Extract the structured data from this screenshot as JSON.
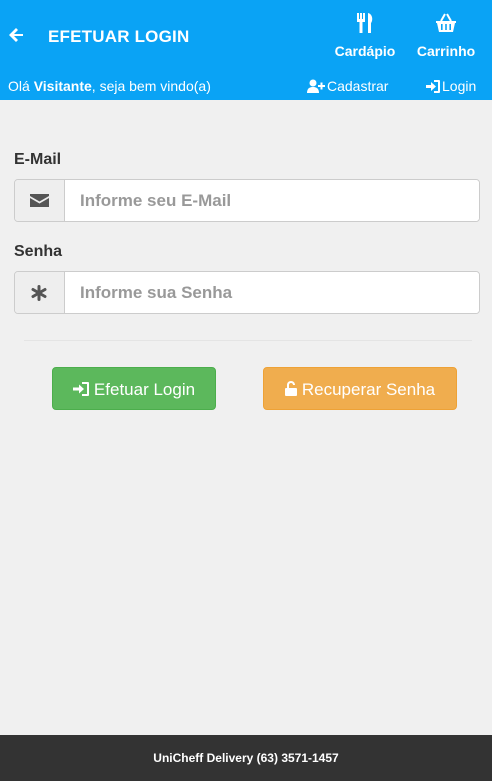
{
  "colors": {
    "header_bg": "#0aa3f5",
    "success": "#5cb85c",
    "warning": "#f0ad4e",
    "footer_bg": "#333333",
    "page_bg": "#f0f0f0"
  },
  "header": {
    "back_icon": "arrow-left-icon",
    "title": "EFETUAR LOGIN",
    "nav": [
      {
        "label": "Cardápio",
        "icon": "cutlery-icon"
      },
      {
        "label": "Carrinho",
        "icon": "basket-icon"
      }
    ]
  },
  "subbar": {
    "greeting_prefix": "Olá ",
    "user": "Visitante",
    "greeting_suffix": ", seja bem vindo(a)",
    "register_label": "Cadastrar",
    "register_icon": "user-plus-icon",
    "login_label": "Login",
    "login_icon": "sign-in-icon"
  },
  "form": {
    "email": {
      "label": "E-Mail",
      "placeholder": "Informe seu E-Mail",
      "value": "",
      "icon": "envelope-icon"
    },
    "password": {
      "label": "Senha",
      "placeholder": "Informe sua Senha",
      "value": "",
      "icon": "asterisk-icon"
    },
    "login_button": {
      "label": "Efetuar Login",
      "icon": "sign-in-icon"
    },
    "recover_button": {
      "label": "Recuperar Senha",
      "icon": "unlock-icon"
    }
  },
  "footer": {
    "text": "UniCheff Delivery (63) 3571-1457"
  }
}
